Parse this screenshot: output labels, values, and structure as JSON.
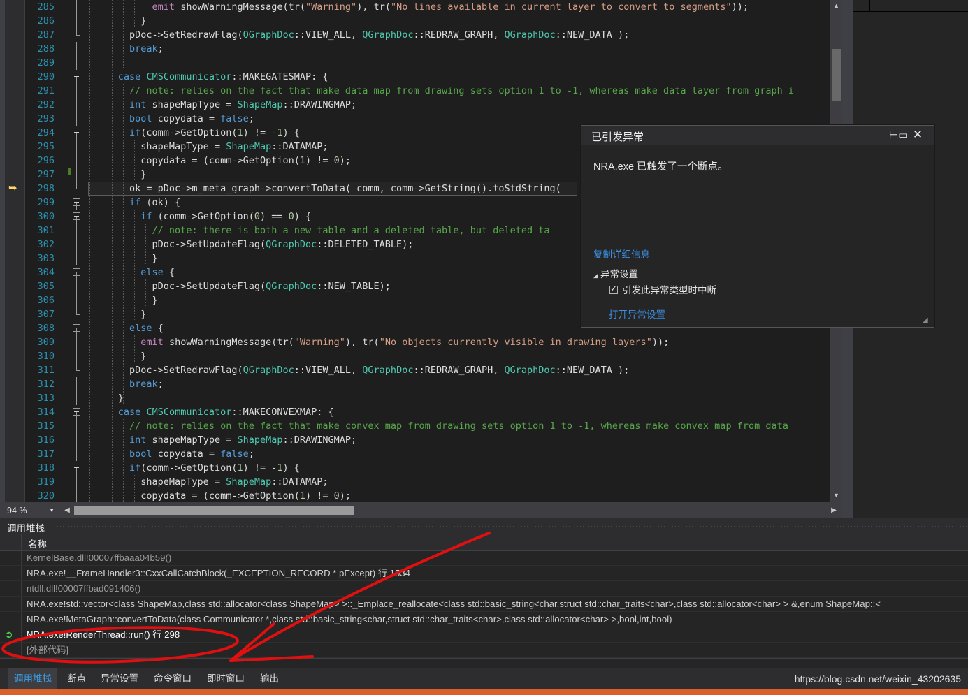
{
  "editor": {
    "zoom_level": "94 %",
    "current_line": 298,
    "lines": [
      {
        "n": 285,
        "indent": 6,
        "fold": "tickonly",
        "html": "            <span class='p'>emit</span> <span class='pl'>showWarningMessage(</span><span class='pl'>tr(</span><span class='s'>\"Warning\"</span><span class='pl'>), tr(</span><span class='s'>\"No lines available in current layer to convert to segments\"</span><span class='pl'>));</span>"
      },
      {
        "n": 286,
        "indent": 6,
        "fold": "tickonly",
        "html": "          <span class='pl'>}</span>"
      },
      {
        "n": 287,
        "indent": 5,
        "fold": "endtick",
        "html": "        <span class='pl'>pDoc-&gt;SetRedrawFlag(</span><span class='kc'>QGraphDoc</span><span class='pl'>::VIEW_ALL, </span><span class='kc'>QGraphDoc</span><span class='pl'>::REDRAW_GRAPH, </span><span class='kc'>QGraphDoc</span><span class='pl'>::NEW_DATA );</span>"
      },
      {
        "n": 288,
        "indent": 5,
        "fold": "line",
        "html": "        <span class='k'>break</span><span class='pl'>;</span>"
      },
      {
        "n": 289,
        "indent": 5,
        "fold": "line",
        "html": ""
      },
      {
        "n": 290,
        "indent": 4,
        "fold": "box",
        "html": "      <span class='k'>case</span> <span class='kc'>CMSCommunicator</span><span class='pl'>::MAKEGATESMAP: {</span>"
      },
      {
        "n": 291,
        "indent": 5,
        "fold": "line",
        "html": "        <span class='c'>// note: relies on the fact that make data map from drawing sets option 1 to -1, whereas make data layer from graph i</span>"
      },
      {
        "n": 292,
        "indent": 5,
        "fold": "line",
        "html": "        <span class='k'>int</span><span class='pl'> shapeMapType = </span><span class='kc'>ShapeMap</span><span class='pl'>::DRAWINGMAP;</span>"
      },
      {
        "n": 293,
        "indent": 5,
        "fold": "line",
        "html": "        <span class='k'>bool</span><span class='pl'> copydata = </span><span class='k'>false</span><span class='pl'>;</span>"
      },
      {
        "n": 294,
        "indent": 5,
        "fold": "box",
        "html": "        <span class='k'>if</span><span class='pl'>(comm-&gt;GetOption(</span><span class='n'>1</span><span class='pl'>) != -</span><span class='n'>1</span><span class='pl'>) {</span>"
      },
      {
        "n": 295,
        "indent": 6,
        "fold": "line",
        "html": "          <span class='pl'>shapeMapType = </span><span class='kc'>ShapeMap</span><span class='pl'>::DATAMAP;</span>"
      },
      {
        "n": 296,
        "indent": 6,
        "fold": "line",
        "html": "          <span class='pl'>copydata = (comm-&gt;GetOption(</span><span class='n'>1</span><span class='pl'>) != </span><span class='n'>0</span><span class='pl'>);</span>"
      },
      {
        "n": 297,
        "indent": 6,
        "fold": "line",
        "html": "          <span class='pl'>}</span>",
        "change": "half"
      },
      {
        "n": 298,
        "indent": 5,
        "fold": "endtick",
        "html": "        <span class='pl'>ok = pDoc-&gt;m_meta_graph-&gt;convertToData( comm, comm-&gt;GetString().toStdString(</span>",
        "current": true,
        "change": "top"
      },
      {
        "n": 299,
        "indent": 5,
        "fold": "box",
        "html": "        <span class='k'>if</span><span class='pl'> (ok) {</span>"
      },
      {
        "n": 300,
        "indent": 6,
        "fold": "box",
        "html": "          <span class='k'>if</span><span class='pl'> (comm-&gt;GetOption(</span><span class='n'>0</span><span class='pl'>) == </span><span class='n'>0</span><span class='pl'>) {</span>"
      },
      {
        "n": 301,
        "indent": 7,
        "fold": "line",
        "html": "            <span class='c'>// note: there is both a new table and a deleted table, but deleted ta</span>"
      },
      {
        "n": 302,
        "indent": 7,
        "fold": "line",
        "html": "            <span class='pl'>pDoc-&gt;SetUpdateFlag(</span><span class='kc'>QGraphDoc</span><span class='pl'>::DELETED_TABLE);</span>"
      },
      {
        "n": 303,
        "indent": 7,
        "fold": "line",
        "html": "            <span class='pl'>}</span>"
      },
      {
        "n": 304,
        "indent": 6,
        "fold": "box",
        "html": "          <span class='k'>else</span><span class='pl'> {</span>"
      },
      {
        "n": 305,
        "indent": 7,
        "fold": "line",
        "html": "            <span class='pl'>pDoc-&gt;SetUpdateFlag(</span><span class='kc'>QGraphDoc</span><span class='pl'>::NEW_TABLE);</span>"
      },
      {
        "n": 306,
        "indent": 7,
        "fold": "line",
        "html": "            <span class='pl'>}</span>"
      },
      {
        "n": 307,
        "indent": 6,
        "fold": "endtick",
        "html": "          <span class='pl'>}</span>"
      },
      {
        "n": 308,
        "indent": 5,
        "fold": "box",
        "html": "        <span class='k'>else</span><span class='pl'> {</span>"
      },
      {
        "n": 309,
        "indent": 6,
        "fold": "line",
        "html": "          <span class='p'>emit</span> <span class='pl'>showWarningMessage(tr(</span><span class='s'>\"Warning\"</span><span class='pl'>), tr(</span><span class='s'>\"No objects currently visible in drawing layers\"</span><span class='pl'>));</span>"
      },
      {
        "n": 310,
        "indent": 6,
        "fold": "line",
        "html": "          <span class='pl'>}</span>"
      },
      {
        "n": 311,
        "indent": 5,
        "fold": "endtick",
        "html": "        <span class='pl'>pDoc-&gt;SetRedrawFlag(</span><span class='kc'>QGraphDoc</span><span class='pl'>::VIEW_ALL, </span><span class='kc'>QGraphDoc</span><span class='pl'>::REDRAW_GRAPH, </span><span class='kc'>QGraphDoc</span><span class='pl'>::NEW_DATA );</span>"
      },
      {
        "n": 312,
        "indent": 5,
        "fold": "line",
        "html": "        <span class='k'>break</span><span class='pl'>;</span>"
      },
      {
        "n": 313,
        "indent": 5,
        "fold": "line",
        "html": "      <span class='pl'>}</span>"
      },
      {
        "n": 314,
        "indent": 4,
        "fold": "box",
        "html": "      <span class='k'>case</span> <span class='kc'>CMSCommunicator</span><span class='pl'>::MAKECONVEXMAP: {</span>"
      },
      {
        "n": 315,
        "indent": 5,
        "fold": "line",
        "html": "        <span class='c'>// note: relies on the fact that make convex map from drawing sets option 1 to -1, whereas make convex map from data</span>"
      },
      {
        "n": 316,
        "indent": 5,
        "fold": "line",
        "html": "        <span class='k'>int</span><span class='pl'> shapeMapType = </span><span class='kc'>ShapeMap</span><span class='pl'>::DRAWINGMAP;</span>"
      },
      {
        "n": 317,
        "indent": 5,
        "fold": "line",
        "html": "        <span class='k'>bool</span><span class='pl'> copydata = </span><span class='k'>false</span><span class='pl'>;</span>"
      },
      {
        "n": 318,
        "indent": 5,
        "fold": "box",
        "html": "        <span class='k'>if</span><span class='pl'>(comm-&gt;GetOption(</span><span class='n'>1</span><span class='pl'>) != -</span><span class='n'>1</span><span class='pl'>) {</span>"
      },
      {
        "n": 319,
        "indent": 6,
        "fold": "line",
        "html": "          <span class='pl'>shapeMapType = </span><span class='kc'>ShapeMap</span><span class='pl'>::DATAMAP;</span>"
      },
      {
        "n": 320,
        "indent": 6,
        "fold": "line",
        "html": "          <span class='pl'>copydata = (comm-&gt;GetOption(</span><span class='n'>1</span><span class='pl'>) != </span><span class='n'>0</span><span class='pl'>);</span>"
      }
    ]
  },
  "exception_dialog": {
    "title": "已引发异常",
    "message": "NRA.exe 已触发了一个断点。",
    "copy_details_link": "复制详细信息",
    "settings_header": "异常设置",
    "checkbox_label": "引发此异常类型时中断",
    "checkbox_checked": true,
    "open_settings_link": "打开异常设置",
    "pin_icon": "pin-icon",
    "close_icon": "close-icon"
  },
  "call_stack": {
    "panel_title": "调用堆栈",
    "column_header": "名称",
    "rows": [
      {
        "text": "KernelBase.dll!00007ffbaaa04b59()",
        "current": false,
        "dim": true
      },
      {
        "text": "NRA.exe!__FrameHandler3::CxxCallCatchBlock(_EXCEPTION_RECORD * pExcept) 行 1534",
        "current": false,
        "dim": false
      },
      {
        "text": "ntdll.dll!00007ffbad091406()",
        "current": false,
        "dim": true
      },
      {
        "text": "NRA.exe!std::vector<class ShapeMap,class std::allocator<class ShapeMap> >::_Emplace_reallocate<class std::basic_string<char,struct std::char_traits<char>,class std::allocator<char> > &,enum ShapeMap::<",
        "current": false,
        "dim": false
      },
      {
        "text": "NRA.exe!MetaGraph::convertToData(class Communicator *,class std::basic_string<char,struct std::char_traits<char>,class std::allocator<char> >,bool,int,bool)",
        "current": false,
        "dim": false
      },
      {
        "text": "NRA.exe!RenderThread::run() 行 298",
        "current": true,
        "dim": false
      },
      {
        "text": "[外部代码]",
        "current": false,
        "dim": true
      }
    ]
  },
  "tabs": {
    "items": [
      {
        "label": "调用堆栈",
        "active": true
      },
      {
        "label": "断点",
        "active": false
      },
      {
        "label": "异常设置",
        "active": false
      },
      {
        "label": "命令窗口",
        "active": false
      },
      {
        "label": "即时窗口",
        "active": false
      },
      {
        "label": "输出",
        "active": false
      }
    ]
  },
  "watermark": "https://blog.csdn.net/weixin_43202635",
  "colors": {
    "accent_blue": "#3b9ae0",
    "link_blue": "#3b8ee0",
    "annotation_red": "#e01010",
    "orange_bar": "#d9602a",
    "editor_bg": "#1e1e1e",
    "panel_bg": "#252526"
  }
}
